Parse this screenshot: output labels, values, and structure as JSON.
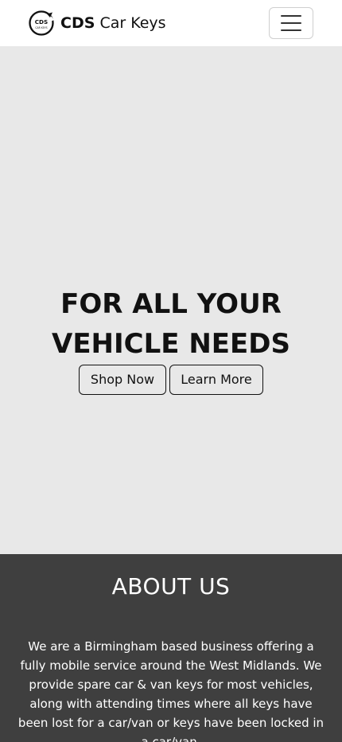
{
  "navbar": {
    "logo_text": "CDS",
    "logo_subtext": "CAR KEYS",
    "brand_bold": "CDS",
    "brand_rest": "Car Keys",
    "menu_icon": "hamburger-icon"
  },
  "hero": {
    "title_line1": "FOR ALL YOUR",
    "title_line2": "VEHICLE NEEDS",
    "buttons": [
      {
        "label": "Shop Now"
      },
      {
        "label": "Learn More"
      }
    ]
  },
  "about": {
    "title": "ABOUT US",
    "text": "We are a Birmingham based business offering a fully mobile service around the West Midlands. We provide spare car & van keys for most vehicles, along with attending times where all keys have been lost for a car/van or keys have been locked in a car/van."
  },
  "colors": {
    "hero_background": "#e8e8e8",
    "about_background": "#3f3f3f",
    "text_dark": "#111111",
    "text_light": "#ffffff"
  }
}
